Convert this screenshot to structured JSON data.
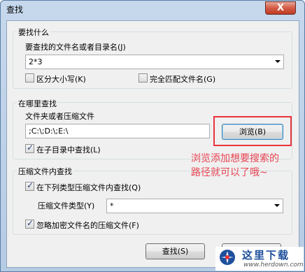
{
  "window": {
    "title": "查找",
    "close_glyph": "X"
  },
  "groups": {
    "what": {
      "label": "要找什么",
      "name_label": "要查找的文件名或者目录名(J)",
      "name_value": "2*3",
      "case_sensitive_label": "区分大小写(K)",
      "case_sensitive_checked": false,
      "whole_name_label": "完全匹配文件名(G)",
      "whole_name_checked": false
    },
    "where": {
      "label": "在哪里查找",
      "folder_label": "文件夹或者压缩文件",
      "folder_value": ";C:\\;D:\\;E:\\",
      "browse_label": "浏览(B)",
      "subdirs_label": "在子目录中查找(L)",
      "subdirs_checked": true
    },
    "archive": {
      "label": "压缩文件内查找",
      "search_types_label": "在下列类型压缩文件内查找(Q)",
      "search_types_checked": true,
      "type_label": "压缩文件类型(Y)",
      "type_value": "*",
      "ignore_encrypted_label": "忽略加密文件名的压缩文件(F)",
      "ignore_encrypted_checked": true
    }
  },
  "buttons": {
    "find": "查找(S)"
  },
  "annotation": {
    "line1": "浏览添加想要搜索的",
    "line2": "路径就可以了哦~",
    "color": "#e84552"
  },
  "watermark": {
    "name": "这里下载",
    "url": "www.herdown.com"
  }
}
